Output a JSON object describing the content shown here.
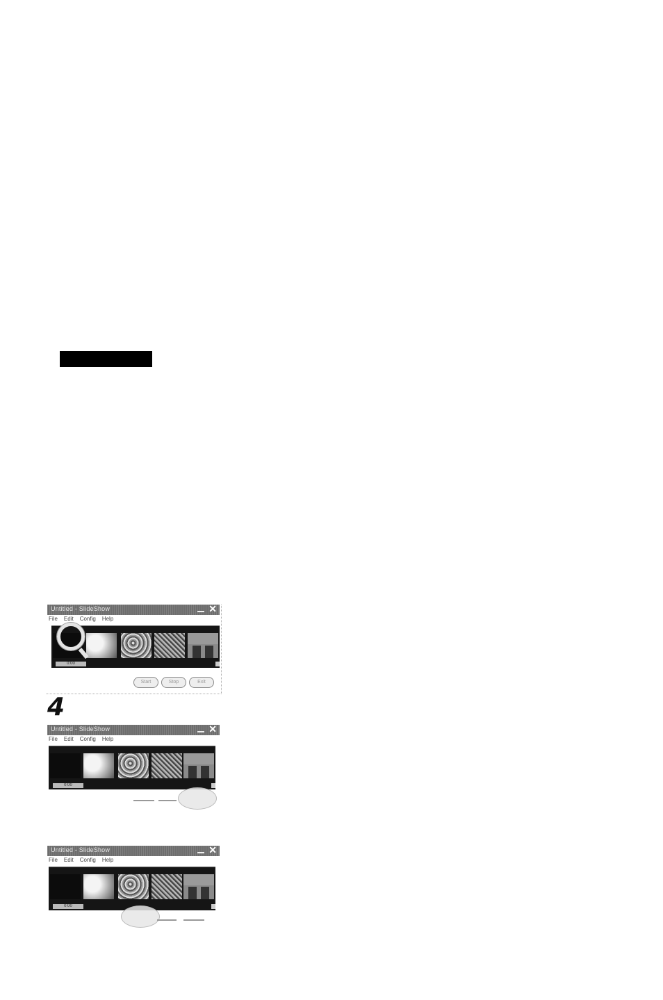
{
  "step_number": "4",
  "windows": [
    {
      "title": "Untitled - SlideShow",
      "menu": [
        "File",
        "Edit",
        "Config",
        "Help"
      ],
      "time_label": "0:00",
      "buttons": [
        "Start",
        "Stop",
        "Exit"
      ]
    },
    {
      "title": "Untitled - SlideShow",
      "menu": [
        "File",
        "Edit",
        "Config",
        "Help"
      ],
      "time_label": "0:00"
    },
    {
      "title": "Untitled - SlideShow",
      "menu": [
        "File",
        "Edit",
        "Config",
        "Help"
      ],
      "time_label": "0:00"
    }
  ]
}
